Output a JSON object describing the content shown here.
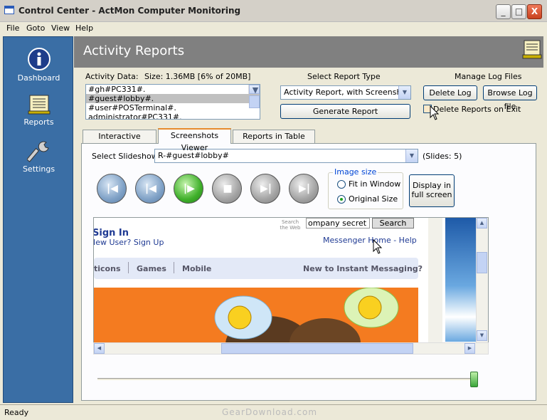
{
  "window": {
    "title": "Control Center - ActMon Computer Monitoring",
    "minimize": "_",
    "maximize": "□",
    "close": "X"
  },
  "menu": [
    "File",
    "Goto",
    "View",
    "Help"
  ],
  "sidebar": [
    {
      "label": "Dashboard",
      "icon": "info-icon"
    },
    {
      "label": "Reports",
      "icon": "reports-icon"
    },
    {
      "label": "Settings",
      "icon": "wrench-icon"
    }
  ],
  "header": {
    "title": "Activity Reports"
  },
  "activity": {
    "label": "Activity Data:",
    "size": "Size: 1.36MB [6% of 20MB]",
    "items": [
      "#gh#PC331#.",
      "#guest#lobby#.",
      "#user#POSTerminal#.",
      "administrator#PC331#."
    ],
    "selected_index": 1
  },
  "report_type": {
    "label": "Select Report Type",
    "value": "Activity Report, with Screenshot",
    "generate": "Generate Report"
  },
  "logs": {
    "label": "Manage Log Files",
    "delete": "Delete Log",
    "browse": "Browse Log file",
    "delete_on_exit": "Delete Reports on Exit"
  },
  "tabs": [
    {
      "label": "Interactive Reports",
      "active": false
    },
    {
      "label": "Screenshots Viewer",
      "active": true
    },
    {
      "label": "Reports in Table Form",
      "active": false
    }
  ],
  "slideshow": {
    "label": "Select Slideshow",
    "value": "R-#guest#lobby#",
    "count": "(Slides: 5)"
  },
  "image_size": {
    "legend": "Image size",
    "options": [
      "Fit in Window",
      "Original Size"
    ],
    "selected": "Original Size"
  },
  "fullscreen": {
    "line1": "Display in",
    "line2": "full screen"
  },
  "screenshot": {
    "search_hint": "Search\nthe Web",
    "search_value": "ompany secret",
    "search_button": "Search",
    "sign_in": "Sign In",
    "new_user": "New User?",
    "sign_up": "Sign Up",
    "messenger": "Messenger Home - Help",
    "nav": [
      "ticons",
      "Games",
      "Mobile"
    ],
    "promo": "New to Instant Messaging?"
  },
  "colors": {
    "sidebar": "#3a6ea5",
    "header": "#808080",
    "accent": "#e68b2c",
    "link": "#1f3a93"
  },
  "status": {
    "text": "Ready",
    "watermark": "GearDownload.com"
  }
}
